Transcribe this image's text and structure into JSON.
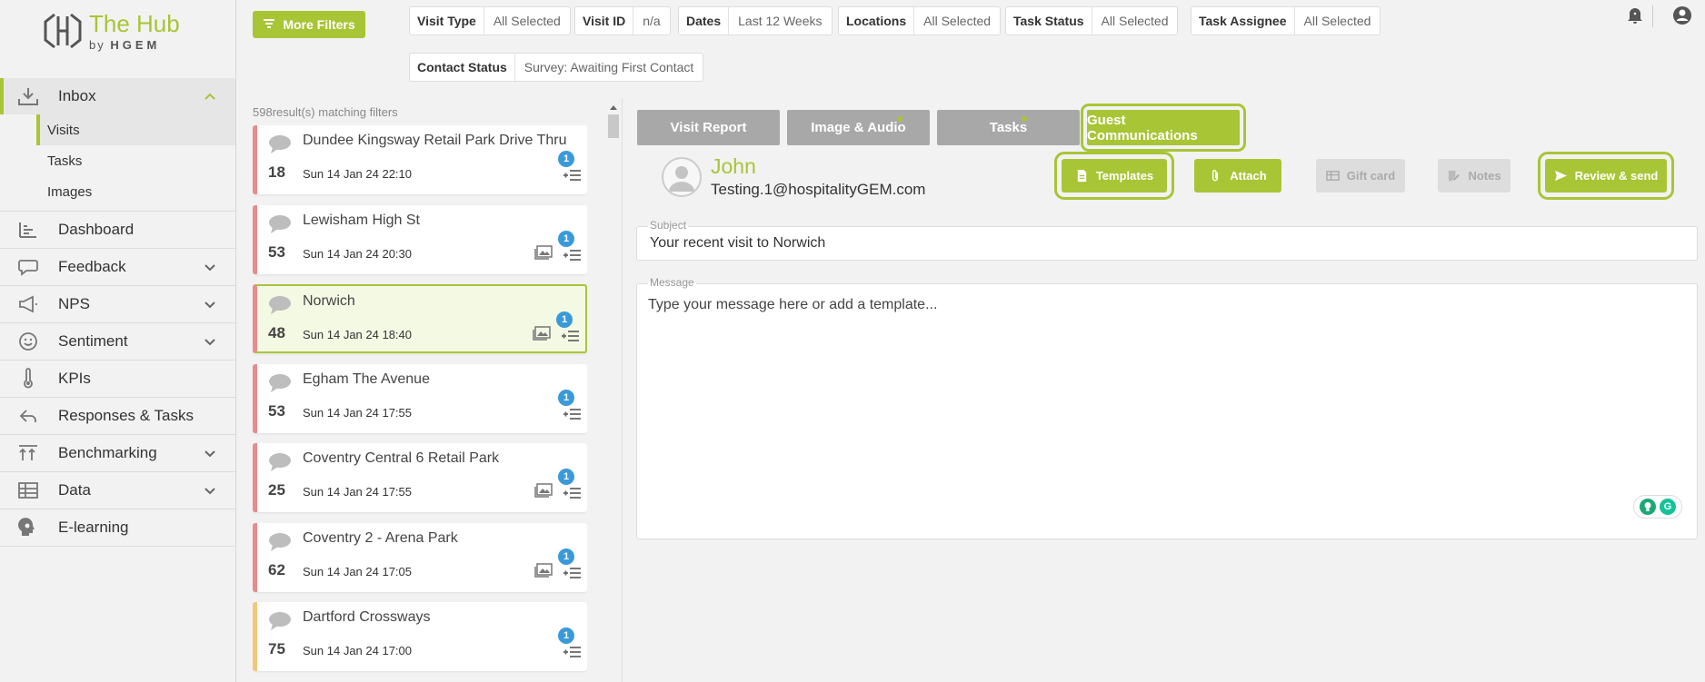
{
  "app": {
    "logo_title": "The Hub",
    "logo_by": "by",
    "logo_brand": "HGEM"
  },
  "sidebar": {
    "inbox": {
      "label": "Inbox",
      "sub": [
        "Visits",
        "Tasks",
        "Images"
      ]
    },
    "items": [
      {
        "label": "Dashboard",
        "icon": "bar-chart-icon",
        "chevron": false
      },
      {
        "label": "Feedback",
        "icon": "speech-bubble-icon",
        "chevron": true
      },
      {
        "label": "NPS",
        "icon": "megaphone-icon",
        "chevron": true
      },
      {
        "label": "Sentiment",
        "icon": "smiley-icon",
        "chevron": true
      },
      {
        "label": "KPIs",
        "icon": "thermometer-icon",
        "chevron": false
      },
      {
        "label": "Responses & Tasks",
        "icon": "reply-icon",
        "chevron": false
      },
      {
        "label": "Benchmarking",
        "icon": "benchmark-icon",
        "chevron": true
      },
      {
        "label": "Data",
        "icon": "table-icon",
        "chevron": true
      },
      {
        "label": "E-learning",
        "icon": "head-gear-icon",
        "chevron": false
      }
    ]
  },
  "filters": {
    "more_label": "More Filters",
    "chips": [
      {
        "key": "Visit Type",
        "value": "All Selected"
      },
      {
        "key": "Visit ID",
        "value": "n/a"
      },
      {
        "key": "Dates",
        "value": "Last 12 Weeks"
      },
      {
        "key": "Locations",
        "value": "All Selected"
      },
      {
        "key": "Task Status",
        "value": "All Selected"
      },
      {
        "key": "Task Assignee",
        "value": "All Selected"
      },
      {
        "key": "Contact Status",
        "value": "Survey: Awaiting First Contact"
      }
    ]
  },
  "list": {
    "results_text": "598result(s) matching filters",
    "cards": [
      {
        "title": "Dundee Kingsway Retail Park Drive Thru",
        "score": "18",
        "date": "Sun 14 Jan 24 22:10",
        "badge": "1",
        "has_image": false,
        "accent": "#e88b8b"
      },
      {
        "title": "Lewisham High St",
        "score": "53",
        "date": "Sun 14 Jan 24 20:30",
        "badge": "1",
        "has_image": true,
        "accent": "#e88b8b"
      },
      {
        "title": "Norwich",
        "score": "48",
        "date": "Sun 14 Jan 24 18:40",
        "badge": "1",
        "has_image": true,
        "accent": "#e88b8b",
        "selected": true
      },
      {
        "title": "Egham The Avenue",
        "score": "53",
        "date": "Sun 14 Jan 24 17:55",
        "badge": "1",
        "has_image": false,
        "accent": "#e88b8b"
      },
      {
        "title": "Coventry Central 6 Retail Park",
        "score": "25",
        "date": "Sun 14 Jan 24 17:55",
        "badge": "1",
        "has_image": true,
        "accent": "#e88b8b"
      },
      {
        "title": "Coventry 2 - Arena Park",
        "score": "62",
        "date": "Sun 14 Jan 24 17:05",
        "badge": "1",
        "has_image": true,
        "accent": "#e88b8b"
      },
      {
        "title": "Dartford Crossways",
        "score": "75",
        "date": "Sun 14 Jan 24 17:00",
        "badge": "1",
        "has_image": false,
        "accent": "#f0c878"
      }
    ]
  },
  "tabs": [
    {
      "label": "Visit Report",
      "dot": false
    },
    {
      "label": "Image & Audio",
      "dot": true
    },
    {
      "label": "Tasks",
      "dot": true
    },
    {
      "label": "Guest Communications",
      "dot": false,
      "active": true
    }
  ],
  "contact": {
    "name": "John",
    "email": "Testing.1@hospitalityGEM.com"
  },
  "actions": {
    "templates": "Templates",
    "attach": "Attach",
    "gift_card": "Gift card",
    "notes": "Notes",
    "review_send": "Review & send"
  },
  "form": {
    "subject_label": "Subject",
    "subject_value": "Your recent visit to Norwich",
    "message_label": "Message",
    "message_placeholder": "Type your message here or add a template..."
  },
  "colors": {
    "brand": "#a8c536",
    "badge": "#3a9ad9",
    "low_score": "#e88b8b",
    "mid_score": "#f0c878"
  }
}
